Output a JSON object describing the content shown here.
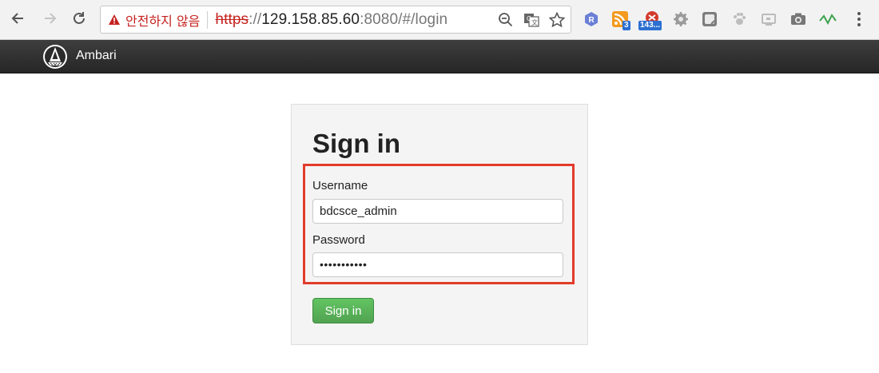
{
  "browser": {
    "security_warning": "안전하지 않음",
    "url": {
      "scheme": "https",
      "separator": "://",
      "host": "129.158.85.60",
      "path": ":8080/#/login"
    },
    "extensions": {
      "rss_badge": "3",
      "counter_badge": "143..."
    }
  },
  "app": {
    "brand": "Ambari"
  },
  "login": {
    "title": "Sign in",
    "username_label": "Username",
    "username_value": "bdcsce_admin",
    "password_label": "Password",
    "password_value": "•••••••••••",
    "submit_label": "Sign in"
  },
  "colors": {
    "warning_red": "#c5221f",
    "highlight_red": "#e23b2a",
    "button_green": "#51a351",
    "topbar_dark": "#2f2f2f"
  }
}
